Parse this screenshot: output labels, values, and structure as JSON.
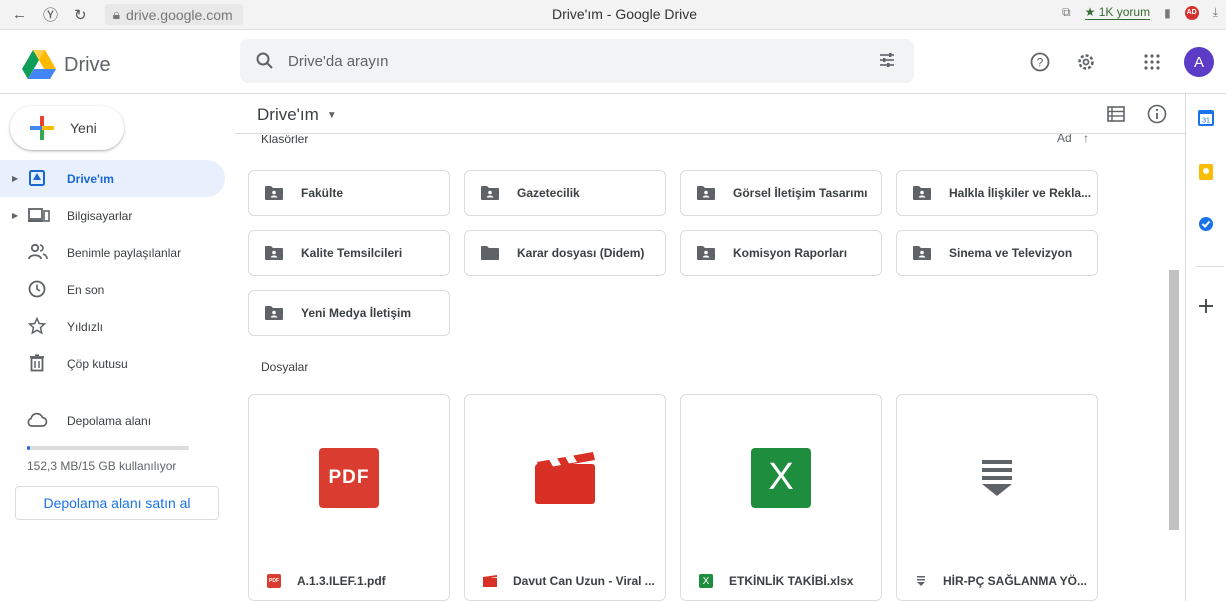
{
  "browser": {
    "url": "drive.google.com",
    "title": "Drive'ım - Google Drive",
    "rating": "★ 1K yorum",
    "adblock_badge": "AD"
  },
  "app": {
    "logo_text": "Drive",
    "search_placeholder": "Drive'da arayın",
    "avatar_letter": "A"
  },
  "sidebar": {
    "new_label": "Yeni",
    "items": [
      {
        "label": "Drive'ım",
        "icon": "my-drive-icon",
        "active": true
      },
      {
        "label": "Bilgisayarlar",
        "icon": "computer-icon",
        "active": false
      },
      {
        "label": "Benimle paylaşılanlar",
        "icon": "shared-icon",
        "active": false
      },
      {
        "label": "En son",
        "icon": "recent-icon",
        "active": false
      },
      {
        "label": "Yıldızlı",
        "icon": "star-icon",
        "active": false
      },
      {
        "label": "Çöp kutusu",
        "icon": "trash-icon",
        "active": false
      }
    ],
    "storage_label": "Depolama alanı",
    "storage_usage": "152,3 MB/15 GB kullanılıyor",
    "storage_fraction": 0.01,
    "buy_storage_label": "Depolama alanı satın al"
  },
  "main": {
    "title": "Drive'ım",
    "folders_label": "Klasörler",
    "sort_label": "Ad",
    "files_label": "Dosyalar",
    "folders": [
      {
        "name": "Fakülte",
        "shared": true
      },
      {
        "name": "Gazetecilik",
        "shared": true
      },
      {
        "name": "Görsel İletişim Tasarımı",
        "shared": true
      },
      {
        "name": "Halkla İlişkiler ve Rekla...",
        "shared": true
      },
      {
        "name": "Kalite Temsilcileri",
        "shared": true
      },
      {
        "name": "Karar dosyası (Didem)",
        "shared": false
      },
      {
        "name": "Komisyon Raporları",
        "shared": true
      },
      {
        "name": "Sinema ve Televizyon",
        "shared": true
      },
      {
        "name": "Yeni Medya İletişim",
        "shared": true
      }
    ],
    "files": [
      {
        "name": "A.1.3.ILEF.1.pdf",
        "type": "pdf",
        "thumb_text": "PDF",
        "color": "#db3c30"
      },
      {
        "name": "Davut Can Uzun - Viral ...",
        "type": "video",
        "thumb_text": "",
        "color": "#d93025"
      },
      {
        "name": "ETKİNLİK TAKİBİ.xlsx",
        "type": "excel",
        "thumb_text": "X",
        "color": "#1e8e3e"
      },
      {
        "name": "HİR-PÇ SAĞLANMA YÖ...",
        "type": "generic",
        "thumb_text": "",
        "color": "#5f6368"
      }
    ]
  }
}
